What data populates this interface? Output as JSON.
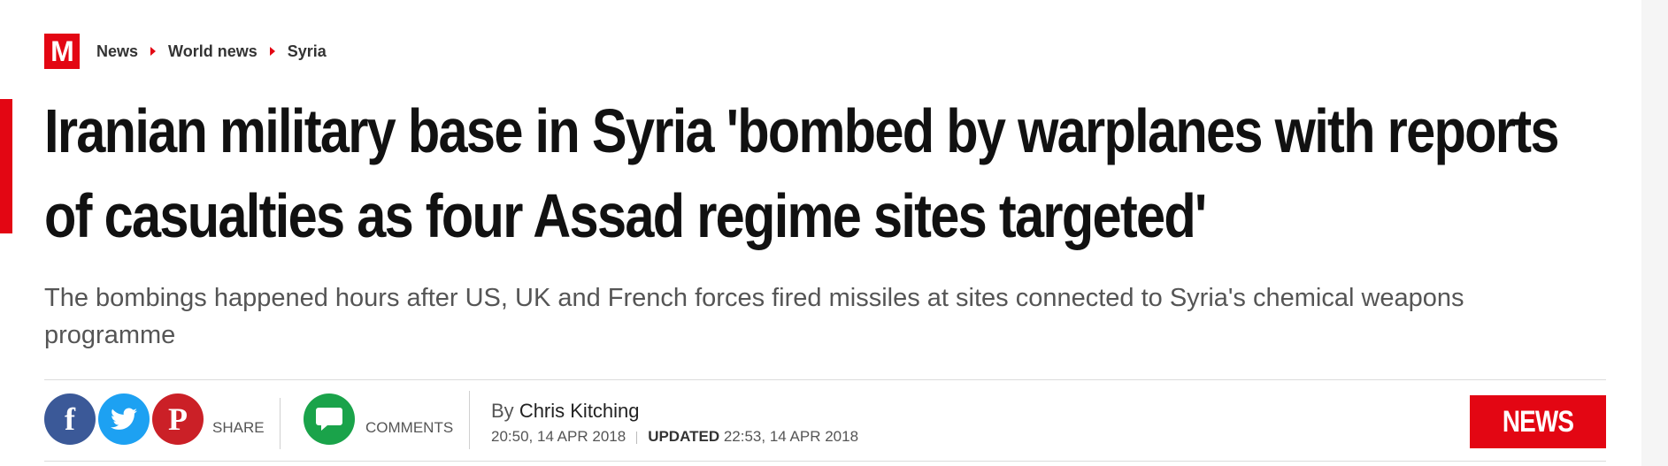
{
  "logo": {
    "text": "M",
    "color": "#e30613"
  },
  "breadcrumb": [
    {
      "label": "News"
    },
    {
      "label": "World news"
    },
    {
      "label": "Syria"
    }
  ],
  "article": {
    "headline": "Iranian military base in Syria 'bombed by warplanes with reports of casualties as four Assad regime sites targeted'",
    "standfirst": "The bombings happened hours after US, UK and French forces fired missiles at sites connected to Syria's chemical weapons programme"
  },
  "share": {
    "facebook_icon": "f",
    "pinterest_icon": "P",
    "label": "SHARE",
    "colors": {
      "facebook": "#3b5998",
      "twitter": "#1da1f2",
      "pinterest": "#cb2027"
    }
  },
  "comments": {
    "label": "COMMENTS",
    "color": "#1aa34a"
  },
  "byline": {
    "prefix": "By",
    "author": "Chris Kitching",
    "published": "20:50, 14 APR 2018",
    "updated_label": "UPDATED",
    "updated": "22:53, 14 APR 2018"
  },
  "section_badge": {
    "label": "NEWS",
    "color": "#e30613"
  }
}
